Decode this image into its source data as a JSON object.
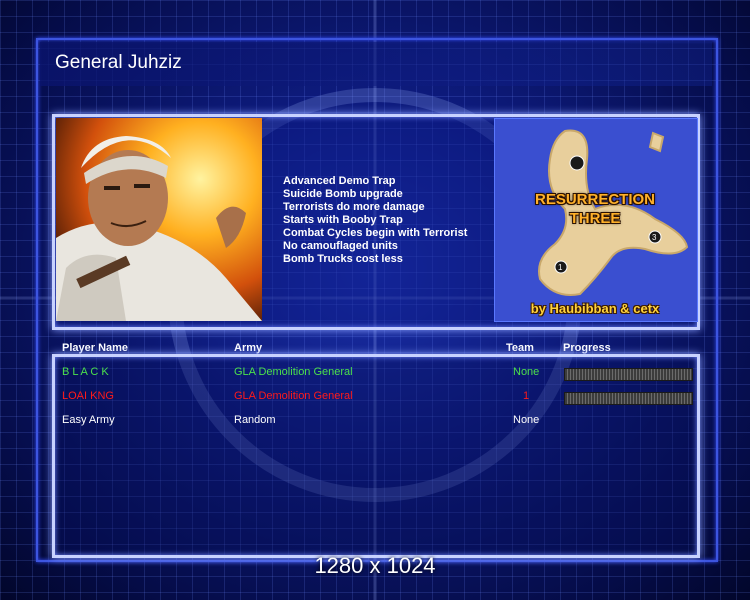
{
  "screen": {
    "title": "General Juhziz",
    "resolution_text": "1280 x 1024"
  },
  "general": {
    "portrait": "gla-demolition-general-portrait",
    "features": [
      "Advanced Demo Trap",
      "Suicide Bomb upgrade",
      "Terrorists do more damage",
      "Starts with Booby Trap",
      "Combat Cycles begin with Terrorist",
      "No camouflaged units",
      "Bomb Trucks cost less"
    ]
  },
  "map": {
    "name_line1": "RESURRECTION",
    "name_line2": "THREE",
    "credit": "by Haubibban & cetx",
    "start_positions": [
      "1",
      "3"
    ]
  },
  "players_table": {
    "headers": {
      "name": "Player Name",
      "army": "Army",
      "team": "Team",
      "progress": "Progress"
    },
    "rows": [
      {
        "name": "B L A C K",
        "army": "GLA Demolition General",
        "team": "None",
        "color": "#4ce04c",
        "show_progress": true
      },
      {
        "name": "LOAI KNG",
        "army": "GLA Demolition General",
        "team": "1",
        "color": "#ff1a1a",
        "show_progress": true
      },
      {
        "name": "Easy Army",
        "army": "Random",
        "team": "None",
        "color": "#ffffff",
        "show_progress": false
      }
    ]
  },
  "colors": {
    "panel_border": "#c8d2ff",
    "background": "#0d1a7a",
    "accent_yellow": "#ffd23a"
  }
}
